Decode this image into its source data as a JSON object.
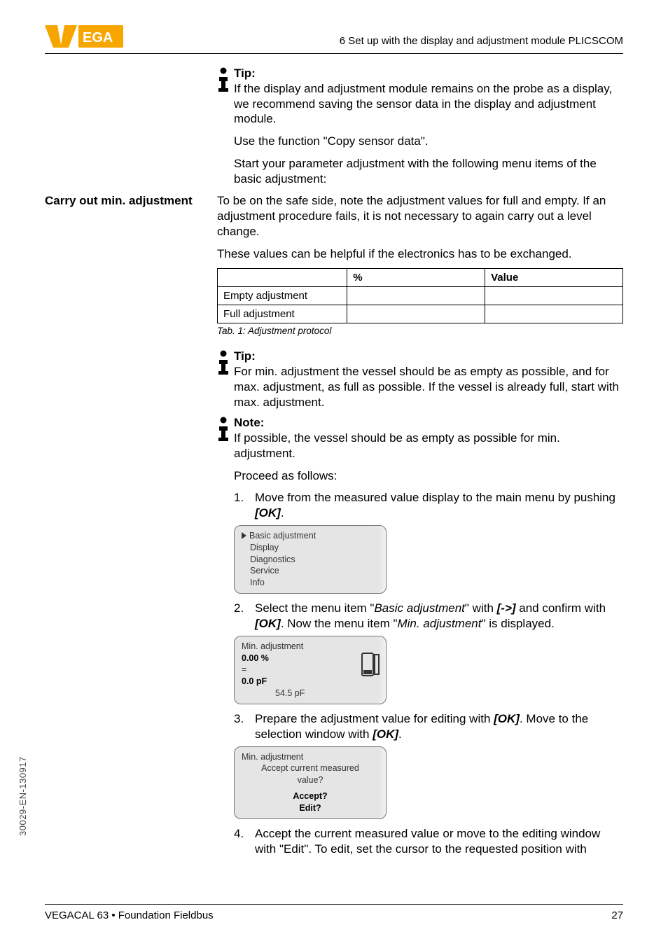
{
  "logo_brand": "VEGA",
  "chapter_header": "6 Set up with the display and adjustment module PLICSCOM",
  "tip1": {
    "heading": "Tip:",
    "p1": "If the display and adjustment module remains on the probe as a display, we recommend saving the sensor data in the display and adjustment module.",
    "p2": "Use the function \"Copy sensor data\".",
    "p3": "Start your parameter adjustment with the following menu items of the basic adjustment:"
  },
  "carry_out": {
    "side": "Carry out min. adjustment",
    "p1": "To be on the safe side, note the adjustment values for full and empty. If an adjustment procedure fails, it is not necessary to again carry out a level change.",
    "p2": "These values can be helpful if the electronics has to be exchanged.",
    "table": {
      "h_percent": "%",
      "h_value": "Value",
      "r1": "Empty adjustment",
      "r2": "Full adjustment"
    },
    "tab_caption": "Tab. 1: Adjustment protocol"
  },
  "tip2": {
    "heading": "Tip:",
    "p1": "For min. adjustment the vessel should be as empty as possible, and for max. adjustment, as full as possible. If the vessel is already full, start with max. adjustment."
  },
  "note": {
    "heading": "Note:",
    "p1": "If possible, the vessel should be as empty as possible for min. adjustment.",
    "p2": "Proceed as follows:"
  },
  "steps": {
    "s1_pre": "Move from the measured value display to the main menu by pushing ",
    "s1_ok": "[OK]",
    "s1_post": ".",
    "lcd1": {
      "l1": "Basic adjustment",
      "l2": "Display",
      "l3": "Diagnostics",
      "l4": "Service",
      "l5": "Info"
    },
    "s2_a": "Select the menu item \"",
    "s2_b_italic": "Basic adjustment",
    "s2_c": "\" with ",
    "s2_arrow": "[->]",
    "s2_d": " and confirm with ",
    "s2_ok": "[OK]",
    "s2_e": ". Now the menu item \"",
    "s2_f_italic": "Min. adjustment",
    "s2_g": "\" is displayed.",
    "lcd2": {
      "l1": "Min. adjustment",
      "l2": "0.00 %",
      "l3": "=",
      "l4": "0.0 pF",
      "l5": "54.5 pF"
    },
    "s3_a": "Prepare the adjustment value for editing with ",
    "s3_ok1": "[OK]",
    "s3_b": ". Move to the selection window with ",
    "s3_ok2": "[OK]",
    "s3_c": ".",
    "lcd3": {
      "l1": "Min. adjustment",
      "l2": "Accept current measured",
      "l3": "value?",
      "l4": "Accept?",
      "l5": "Edit?"
    },
    "s4_a": "Accept the current measured value or move to the editing window with \"Edit\". To edit, set the cursor to the requested position with"
  },
  "footer": {
    "left": "VEGACAL 63 • Foundation Fieldbus",
    "right": "27"
  },
  "doc_code": "30029-EN-130917"
}
